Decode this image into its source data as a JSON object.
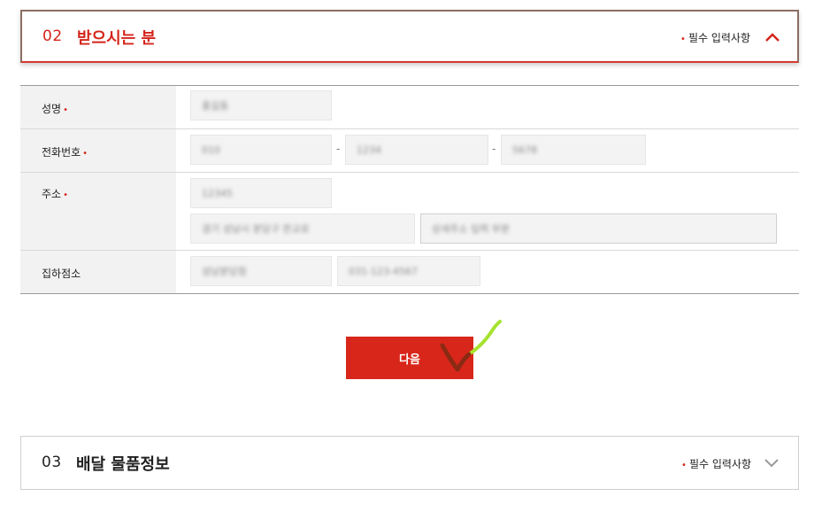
{
  "section_recipient": {
    "number": "02",
    "title": "받으시는 분",
    "required_note": "필수 입력사항",
    "expanded": true
  },
  "form": {
    "rows": [
      {
        "label": "성명",
        "required": true,
        "fields": [
          "홍길동"
        ]
      },
      {
        "label": "전화번호",
        "required": true,
        "fields": [
          "010",
          "1234",
          "5678"
        ]
      },
      {
        "label": "주소",
        "required": true,
        "fields": [
          "12345",
          "경기 성남시 분당구 판교로",
          "상세주소 입력 부분"
        ]
      },
      {
        "label": "집하점소",
        "required": false,
        "fields": [
          "성남분당점",
          "031-123-4567"
        ]
      }
    ],
    "phone_separators": [
      "-",
      "-"
    ]
  },
  "next_button": {
    "label": "다음"
  },
  "section_delivery": {
    "number": "03",
    "title": "배달 물품정보",
    "required_note": "필수 입력사항",
    "expanded": false
  },
  "colors": {
    "accent": "#d8261b",
    "header_border": "#8a6e63",
    "label_bg": "#f2f2f2",
    "field_bg": "#f3f3f3",
    "check_green": "#a6e22e",
    "check_brown": "#8b2a12"
  }
}
